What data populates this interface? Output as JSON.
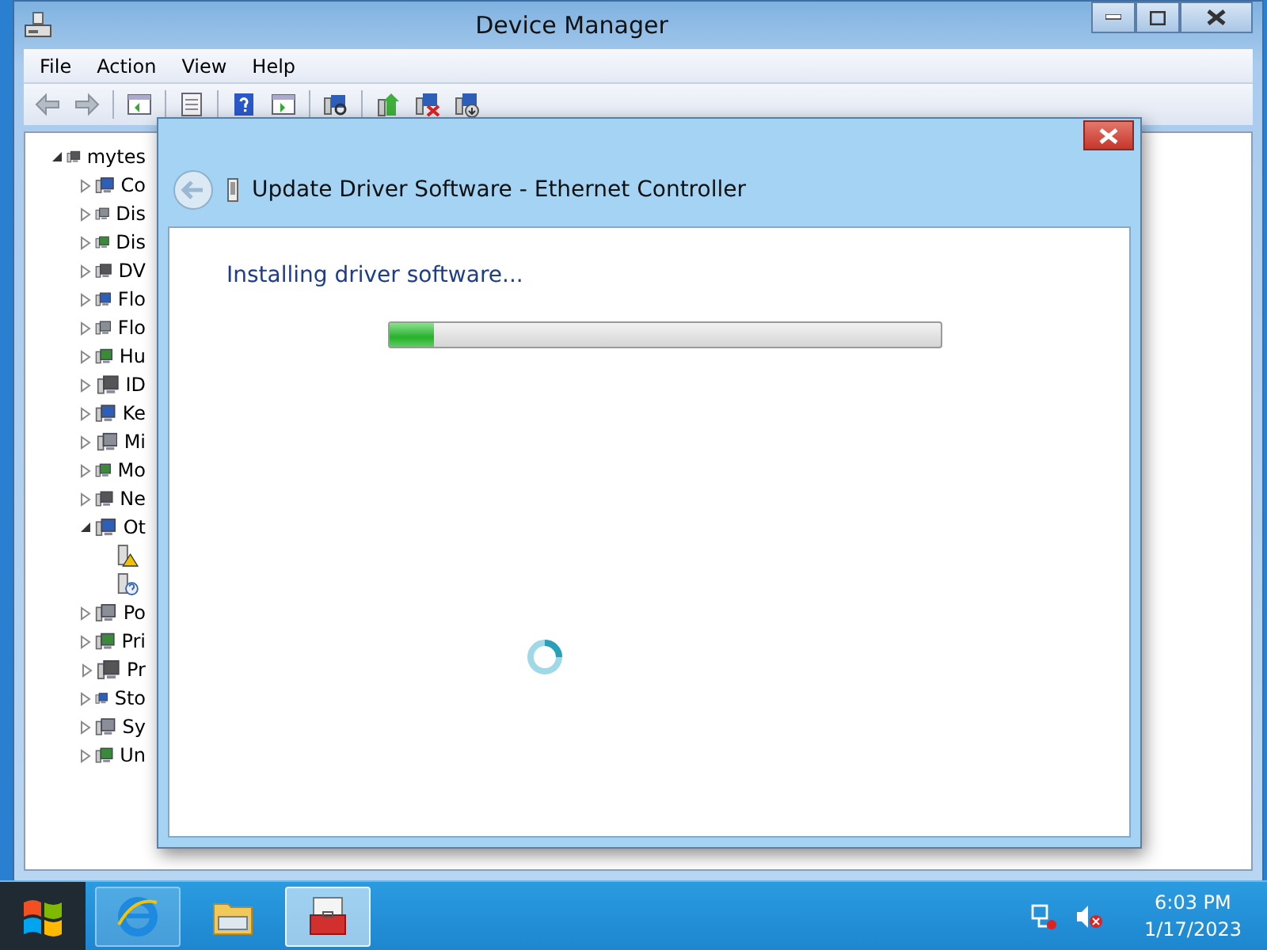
{
  "window": {
    "title": "Device Manager"
  },
  "menu": [
    "File",
    "Action",
    "View",
    "Help"
  ],
  "tree": {
    "label": "mytes",
    "expanded": true,
    "children": [
      {
        "label": "Co",
        "expanded": false
      },
      {
        "label": "Dis",
        "expanded": false
      },
      {
        "label": "Dis",
        "expanded": false
      },
      {
        "label": "DV",
        "expanded": false
      },
      {
        "label": "Flo",
        "expanded": false
      },
      {
        "label": "Flo",
        "expanded": false
      },
      {
        "label": "Hu",
        "expanded": false
      },
      {
        "label": "ID",
        "expanded": false
      },
      {
        "label": "Ke",
        "expanded": false
      },
      {
        "label": "Mi",
        "expanded": false
      },
      {
        "label": "Mo",
        "expanded": false
      },
      {
        "label": "Ne",
        "expanded": false
      },
      {
        "label": "Ot",
        "expanded": true,
        "children": [
          {
            "kind": "warning"
          },
          {
            "kind": "unknown"
          }
        ]
      },
      {
        "label": "Po",
        "expanded": false
      },
      {
        "label": "Pri",
        "expanded": false
      },
      {
        "label": "Pr",
        "expanded": false
      },
      {
        "label": "Sto",
        "expanded": false
      },
      {
        "label": "Sy",
        "expanded": false
      },
      {
        "label": "Un",
        "expanded": false
      }
    ]
  },
  "dialog": {
    "title": "Update Driver Software - Ethernet Controller",
    "status": "Installing driver software...",
    "progress": {
      "level": 0.08
    }
  },
  "taskbar": {
    "apps": [
      {
        "kind": "browser",
        "selected": false,
        "running": true
      },
      {
        "kind": "folder",
        "selected": false,
        "running": false
      },
      {
        "kind": "toolbox",
        "selected": true,
        "running": true
      }
    ],
    "time": "6:03 PM",
    "date": "1/17/2023"
  }
}
